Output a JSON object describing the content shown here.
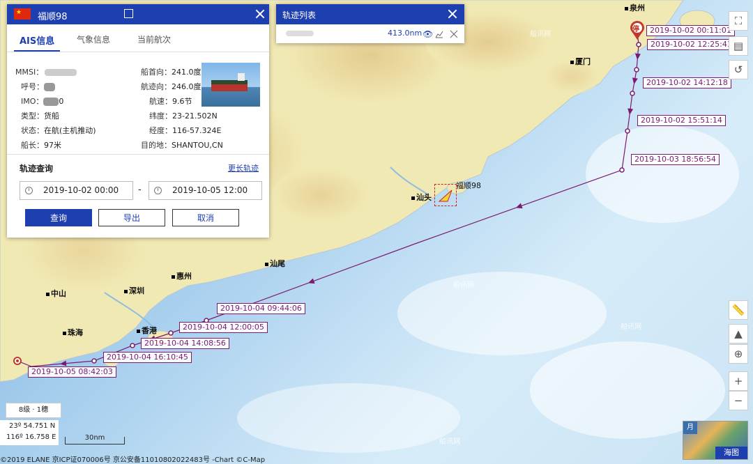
{
  "ais_panel": {
    "ship_name": "福顺98",
    "tabs": [
      "AIS信息",
      "气象信息",
      "当前航次"
    ],
    "fields_left": [
      {
        "k": "MMSI：",
        "v": ""
      },
      {
        "k": "呼号：",
        "v": ""
      },
      {
        "k": "IMO：",
        "v": "0"
      },
      {
        "k": "类型：",
        "v": "货船"
      },
      {
        "k": "状态：",
        "v": "在航(主机推动)"
      },
      {
        "k": "船长：",
        "v": "97米"
      }
    ],
    "fields_right": [
      {
        "k": "船首向：",
        "v": "241.0度"
      },
      {
        "k": "航迹向：",
        "v": "246.0度"
      },
      {
        "k": "航速：",
        "v": "9.6节"
      },
      {
        "k": "纬度：",
        "v": "23-21.502N"
      },
      {
        "k": "经度：",
        "v": "116-57.324E"
      },
      {
        "k": "目的地：",
        "v": "SHANTOU,CN"
      }
    ],
    "track_query_title": "轨迹查询",
    "longer_track": "更长轨迹",
    "start_time": "2019-10-02 00:00",
    "end_time": "2019-10-05 12:00",
    "dash": "-",
    "btn_query": "查询",
    "btn_export": "导出",
    "btn_cancel": "取消"
  },
  "track_list": {
    "title": "轨迹列表",
    "distance": "413.0nm"
  },
  "map": {
    "cities": [
      "泉州",
      "厦门",
      "汕头",
      "汕尾",
      "惠州",
      "深圳",
      "中山",
      "珠海",
      "香港"
    ],
    "ship_label": "福顺98",
    "stop_label": "停",
    "track_times": [
      "2019-10-02 00:11:01",
      "2019-10-02 12:25:41",
      "2019-10-02 14:12:18",
      "2019-10-02 15:51:14",
      "2019-10-03 18:56:54",
      "2019-10-04 09:44:06",
      "2019-10-04 12:00:05",
      "2019-10-04 14:08:56",
      "2019-10-04 16:10:45",
      "2019-10-05 08:42:03"
    ],
    "watermark": "船讯网"
  },
  "scale_box": {
    "level": "8级 · 1穗",
    "lat": "23º 54.751 N",
    "lon": "116º 16.758 E",
    "scale": "30nm"
  },
  "footer": "©2019 ELANE 京ICP证070006号 京公安备11010802022483号 -Chart ©C-Map",
  "minimap_label": "海图",
  "minimap_month": "月",
  "colors": {
    "brand": "#1e3fb0",
    "track": "#7b1a6e",
    "land": "#f1e9b4",
    "sea": "#a9d0ee",
    "stop": "#c0392b"
  }
}
